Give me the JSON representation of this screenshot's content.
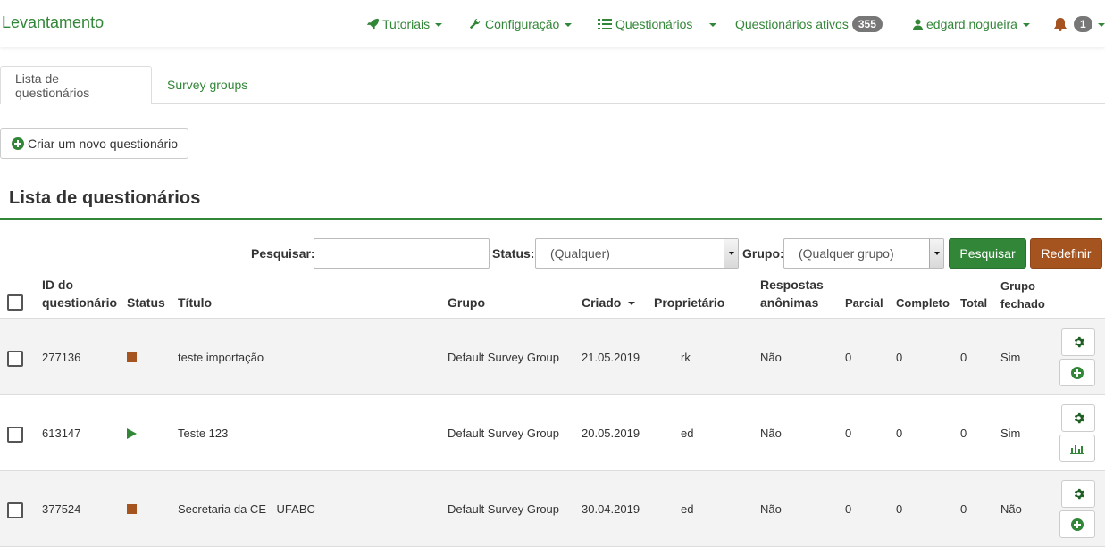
{
  "navbar": {
    "brand": "Levantamento",
    "tutoriais": "Tutoriais",
    "configuracao": "Configuração",
    "questionarios": "Questionários",
    "ativos": "Questionários ativos",
    "ativos_count": "355",
    "user": "edgard.nogueira",
    "notifications_count": "1"
  },
  "tabs": {
    "active": "Lista de questionários",
    "inactive": "Survey groups"
  },
  "create_button": "Criar um novo questionário",
  "heading": "Lista de questionários",
  "filters": {
    "search_label": "Pesquisar:",
    "search_value": "",
    "status_label": "Status:",
    "status_value": "(Qualquer)",
    "group_label": "Grupo:",
    "group_value": "(Qualquer grupo)",
    "search_button": "Pesquisar",
    "reset_button": "Redefinir"
  },
  "columns": {
    "id_line1": "ID do",
    "id_line2": "questionário",
    "status": "Status",
    "title": "Título",
    "group": "Grupo",
    "created": "Criado",
    "owner": "Proprietário",
    "anon_line1": "Respostas",
    "anon_line2": "anônimas",
    "partial": "Parcial",
    "complete": "Completo",
    "total": "Total",
    "closed_line1": "Grupo",
    "closed_line2": "fechado"
  },
  "rows": [
    {
      "id": "277136",
      "status": "stopped",
      "title": "teste importação",
      "group": "Default Survey Group",
      "created": "21.05.2019",
      "owner": "rk",
      "anon": "Não",
      "partial": "0",
      "complete": "0",
      "total": "0",
      "closed": "Sim",
      "second_action": "add"
    },
    {
      "id": "613147",
      "status": "active",
      "title": "Teste 123",
      "group": "Default Survey Group",
      "created": "20.05.2019",
      "owner": "ed",
      "anon": "Não",
      "partial": "0",
      "complete": "0",
      "total": "0",
      "closed": "Sim",
      "second_action": "stats"
    },
    {
      "id": "377524",
      "status": "stopped",
      "title": "Secretaria da CE - UFABC",
      "group": "Default Survey Group",
      "created": "30.04.2019",
      "owner": "ed",
      "anon": "Não",
      "partial": "0",
      "complete": "0",
      "total": "0",
      "closed": "Não",
      "second_action": "add"
    }
  ],
  "colors": {
    "primary_green": "#328637",
    "reset_brown": "#a5531f",
    "badge_gray": "#777777"
  }
}
